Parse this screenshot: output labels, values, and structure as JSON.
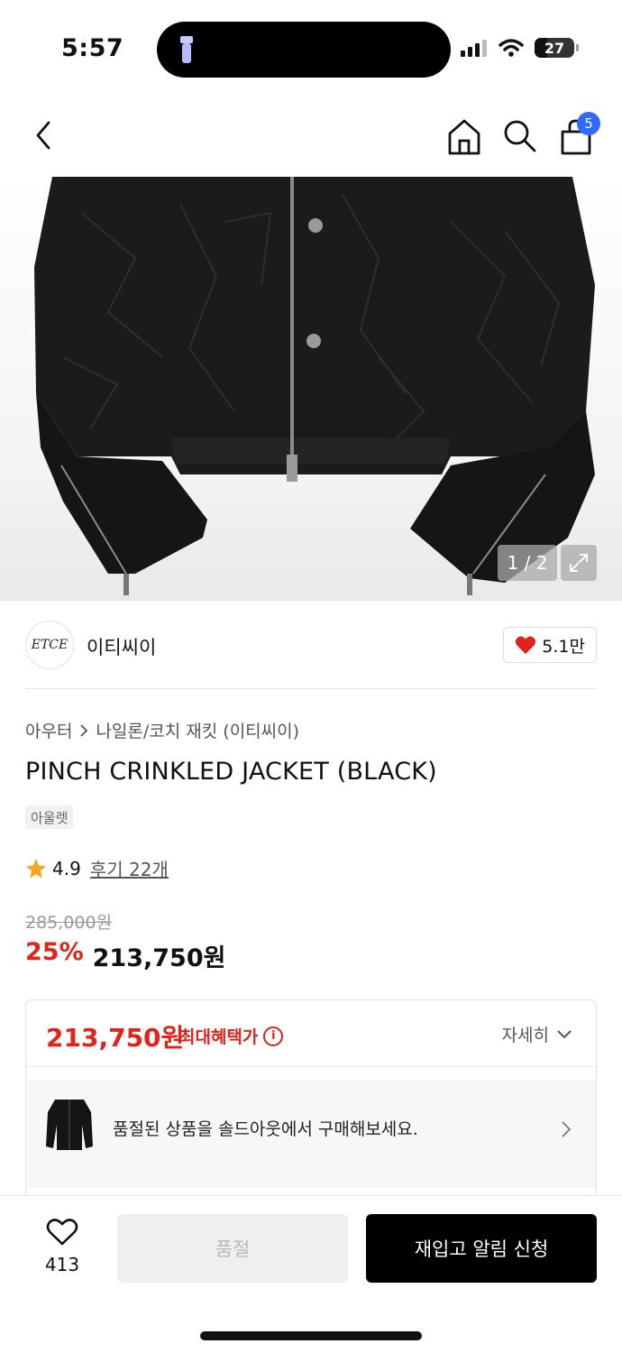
{
  "status_bar": {
    "time": "5:57",
    "battery": "27"
  },
  "nav": {
    "cart_count": "5"
  },
  "gallery": {
    "counter": "1 / 2"
  },
  "brand": {
    "logo_text": "ETCE",
    "name": "이티씨이",
    "likes": "5.1만"
  },
  "breadcrumb": {
    "category": "아우터",
    "subcategory": "나일론/코치 재킷 (이티씨이)"
  },
  "product": {
    "title": "PINCH CRINKLED JACKET (BLACK)",
    "tag": "아울렛",
    "rating": "4.9",
    "reviews": "후기 22개",
    "original_price": "285,000원",
    "discount": "25%",
    "price": "213,750원"
  },
  "benefit": {
    "price": "213,750원",
    "label": "최대혜택가",
    "detail": "자세히",
    "soldout_message": "품절된 상품을 솔드아웃에서 구매해보세요."
  },
  "bottom": {
    "wish_count": "413",
    "soldout_label": "품절",
    "notify_label": "재입고 알림 신청"
  },
  "colors": {
    "accent_red": "#e2231a",
    "badge_blue": "#2f6bff"
  }
}
